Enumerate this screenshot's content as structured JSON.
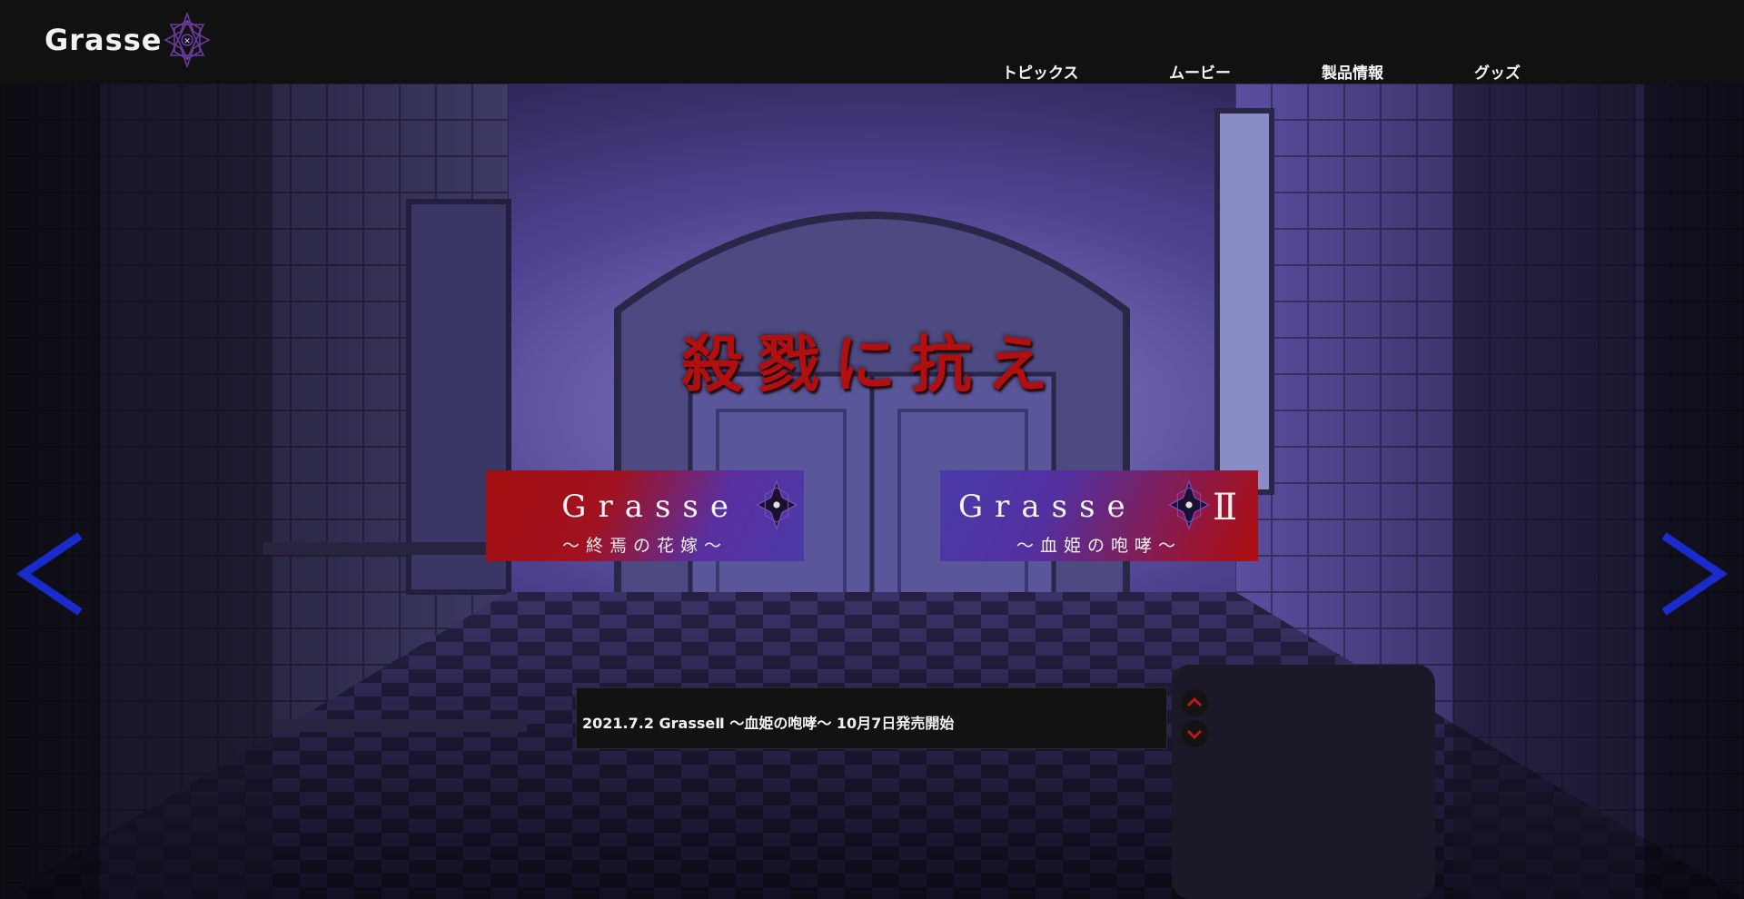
{
  "brand": {
    "name": "Grasse"
  },
  "nav": {
    "items": [
      {
        "label": "トピックス"
      },
      {
        "label": "ムービー"
      },
      {
        "label": "製品情報"
      },
      {
        "label": "グッズ"
      }
    ]
  },
  "hero": {
    "tagline": "殺戮に抗え",
    "prev_icon": "chevron-left-icon",
    "next_icon": "chevron-right-icon"
  },
  "banners": [
    {
      "title": "Grasse",
      "subtitle": "～終焉の花嫁～",
      "numeral": ""
    },
    {
      "title": "Grasse",
      "subtitle": "～血姫の咆哮～",
      "numeral": "Ⅱ"
    }
  ],
  "news": {
    "items": [
      {
        "text": "2021.7.2 GrasseⅡ ～血姫の咆哮～ 10月7日発売開始"
      }
    ],
    "up_icon": "chevron-up-icon",
    "down_icon": "chevron-down-icon"
  },
  "colors": {
    "header_bg": "#111111",
    "tagline": "#b21010",
    "arrow": "#1a2bcc",
    "news_bg": "#121212",
    "news_arrow": "#c01818",
    "logo_star": "#5a2a8a"
  }
}
